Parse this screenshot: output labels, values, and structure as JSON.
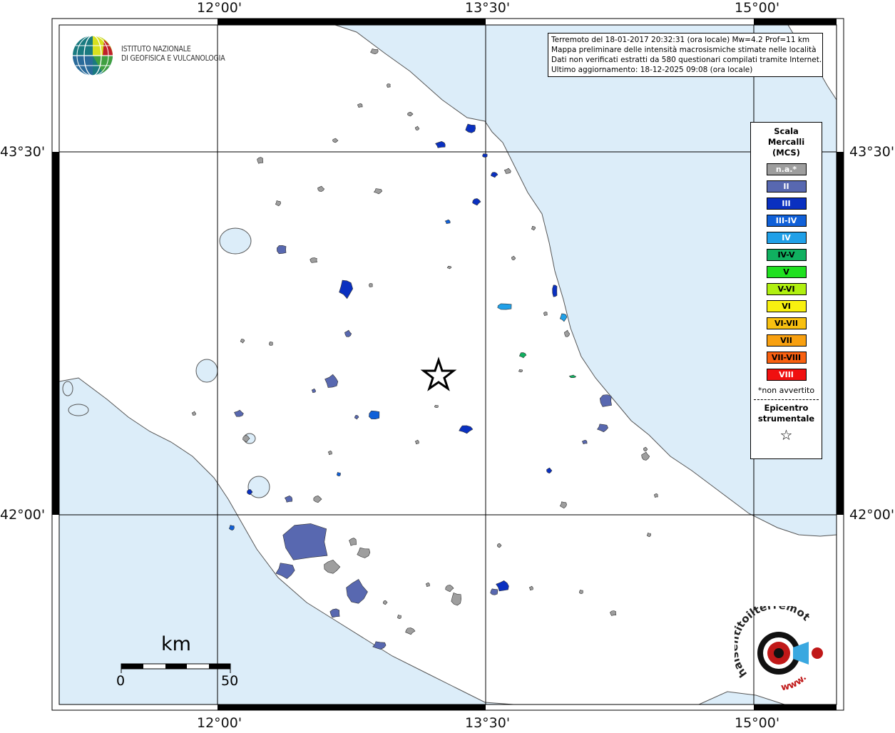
{
  "info": {
    "line1": "Terremoto del 18-01-2017 20:32:31 (ora locale) Mw=4.2 Prof=11 km",
    "line2": "Mappa preliminare delle intensità macrosismiche stimate nelle località",
    "line3": "Dati non verificati estratti da 580 questionari compilati tramite Internet.",
    "line4": "Ultimo aggiornamento: 18-12-2025 09:08 (ora locale)"
  },
  "logo": {
    "line1": "ISTITUTO NAZIONALE",
    "line2": "DI GEOFISICA E VULCANOLOGIA"
  },
  "legend": {
    "title_line1": "Scala",
    "title_line2": "Mercalli",
    "title_line3": "(MCS)",
    "items": [
      {
        "label": "n.a.*",
        "color": "#9e9e9e",
        "text_color": "#ffffff"
      },
      {
        "label": "II",
        "color": "#5868b0",
        "text_color": "#ffffff"
      },
      {
        "label": "III",
        "color": "#0a30c0",
        "text_color": "#ffffff"
      },
      {
        "label": "III-IV",
        "color": "#1060d8",
        "text_color": "#ffffff"
      },
      {
        "label": "IV",
        "color": "#20a0e8",
        "text_color": "#ffffff"
      },
      {
        "label": "IV-V",
        "color": "#10b060",
        "text_color": "#000000"
      },
      {
        "label": "V",
        "color": "#20e020",
        "text_color": "#000000"
      },
      {
        "label": "V-VI",
        "color": "#b0f010",
        "text_color": "#000000"
      },
      {
        "label": "VI",
        "color": "#f8f010",
        "text_color": "#000000"
      },
      {
        "label": "VI-VII",
        "color": "#f8c010",
        "text_color": "#000000"
      },
      {
        "label": "VII",
        "color": "#f8a010",
        "text_color": "#000000"
      },
      {
        "label": "VII-VIII",
        "color": "#f86010",
        "text_color": "#000000"
      },
      {
        "label": "VIII",
        "color": "#f01010",
        "text_color": "#ffffff"
      }
    ],
    "note": "*non avvertito",
    "epicenter_line1": "Epicentro",
    "epicenter_line2": "strumentale",
    "epicenter_symbol": "☆"
  },
  "coords": {
    "lon_12": "12°00'",
    "lon_1330": "13°30'",
    "lon_15": "15°00'",
    "lat_4330": "43°30'",
    "lat_42": "42°00'"
  },
  "scalebar": {
    "unit": "km",
    "start": "0",
    "end": "50"
  },
  "hsit": {
    "text_top": "haisentitoilterremoto.it",
    "text_bottom": "www."
  },
  "colors": {
    "sea": "#dcedf9",
    "land": "#ffffff",
    "epicenter_star": "#000000"
  }
}
